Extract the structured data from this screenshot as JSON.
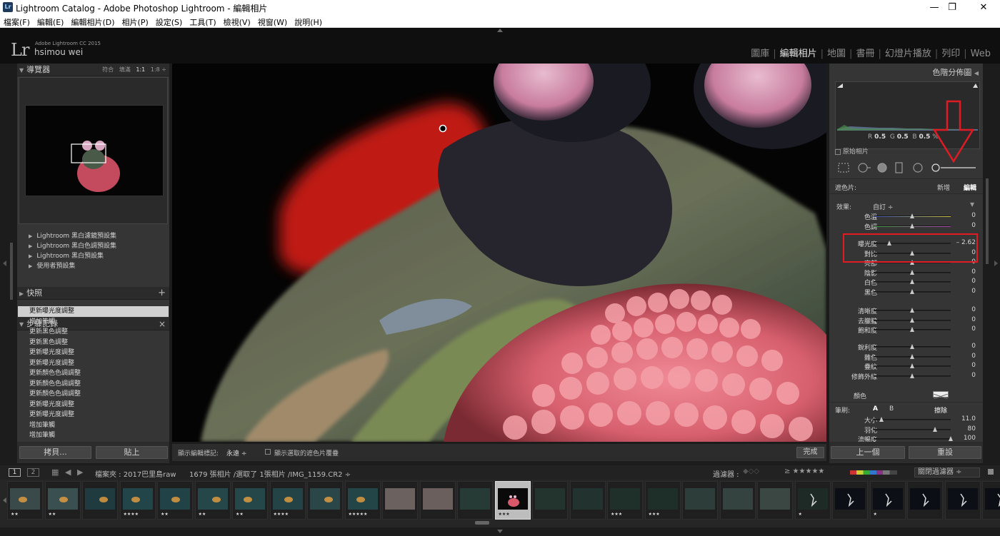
{
  "window": {
    "title": "Lightroom Catalog - Adobe Photoshop Lightroom - 編輯相片",
    "app_icon": "Lr",
    "minimize": "—",
    "maximize": "❐",
    "close": "✕"
  },
  "menu": [
    "檔案(F)",
    "編輯(E)",
    "編輯相片(D)",
    "相片(P)",
    "設定(S)",
    "工具(T)",
    "檢視(V)",
    "視窗(W)",
    "說明(H)"
  ],
  "identity": {
    "logo": "Lr",
    "product": "Adobe Lightroom CC 2015",
    "user": "hsimou wei"
  },
  "modules": [
    "圖庫",
    "編輯相片",
    "地圖",
    "書冊",
    "幻燈片播放",
    "列印",
    "Web"
  ],
  "active_module": "編輯相片",
  "navigator": {
    "title": "導覽器",
    "zoom_options": [
      "符合",
      "填滿",
      "1:1",
      "1:8 ÷"
    ]
  },
  "presets": [
    "Lightroom 黑白濾鏡預設集",
    "Lightroom 黑白色調預設集",
    "Lightroom 黑白預設集",
    "使用者預設集"
  ],
  "snapshots": {
    "title": "快照",
    "add": "+"
  },
  "history": {
    "title": "步驟記錄",
    "close": "×",
    "items": [
      "更新曝光度調整",
      "增加筆觸",
      "更新黑色調整",
      "更新黑色調整",
      "更新曝光度調整",
      "更新曝光度調整",
      "更新顏色色調調整",
      "更新顏色色調調整",
      "更新顏色色調調整",
      "更新曝光度調整",
      "更新曝光度調整",
      "增加筆觸",
      "增加筆觸"
    ]
  },
  "left_buttons": {
    "copy": "拷貝...",
    "paste": "貼上"
  },
  "histogram": {
    "title": "色階分佈圖",
    "readout": [
      "R",
      "0.5",
      "G",
      "0.5",
      "B",
      "0.5",
      "%"
    ],
    "original_label": "原始相片"
  },
  "mask": {
    "label": "遮色片:",
    "new": "新增",
    "edit": "編輯",
    "effect_label": "效果:",
    "effect_value": "自訂 ÷"
  },
  "sliders": {
    "group1": [
      {
        "label": "色溫",
        "value": "0",
        "pos": 0.5
      },
      {
        "label": "色調",
        "value": "0",
        "pos": 0.5
      }
    ],
    "group2": [
      {
        "label": "曝光度",
        "value": "– 2.62",
        "pos": 0.2
      },
      {
        "label": "對比",
        "value": "0",
        "pos": 0.5
      },
      {
        "label": "亮部",
        "value": "0",
        "pos": 0.5
      },
      {
        "label": "陰影",
        "value": "0",
        "pos": 0.5
      },
      {
        "label": "白色",
        "value": "0",
        "pos": 0.5
      },
      {
        "label": "黑色",
        "value": "0",
        "pos": 0.5
      }
    ],
    "group3": [
      {
        "label": "清晰度",
        "value": "0",
        "pos": 0.5
      },
      {
        "label": "去朦朧",
        "value": "0",
        "pos": 0.5
      },
      {
        "label": "飽和度",
        "value": "0",
        "pos": 0.5
      }
    ],
    "group4": [
      {
        "label": "銳利度",
        "value": "0",
        "pos": 0.5
      },
      {
        "label": "雜色",
        "value": "0",
        "pos": 0.5
      },
      {
        "label": "疊紋",
        "value": "0",
        "pos": 0.5
      },
      {
        "label": "修飾外緣",
        "value": "0",
        "pos": 0.5
      }
    ]
  },
  "color_label": "顏色",
  "brush": {
    "label": "筆刷:",
    "a": "A",
    "b": "B",
    "erase": "擦除",
    "size_label": "大小",
    "size_value": "11.0",
    "size_pos": 0.1,
    "feather_label": "羽化",
    "feather_value": "80",
    "feather_pos": 0.8,
    "flow_label": "流暢度",
    "flow_value": "100",
    "flow_pos": 1.0
  },
  "right_buttons": {
    "previous": "上一個",
    "reset": "重設"
  },
  "toolbar": {
    "show_edit_pins": "顯示編輯標記:",
    "edit_pins_value": "永遠 ÷",
    "show_mask_overlay": "顯示選取的遮色片覆疊",
    "done": "完成"
  },
  "filmstrip_bar": {
    "page1": "1",
    "page2": "2",
    "folder": "檔案夾 : 2017巴里島raw",
    "count": "1679 張相片 /選取了 1張相片 /IMG_1159.CR2 ÷",
    "filter_label": "過濾器 :",
    "stars_filter": "≥ ★★★★★",
    "filter_off": "關閉過濾器 ÷"
  },
  "filmstrip": [
    {
      "stars": "★★",
      "tone": "#3a4a4a"
    },
    {
      "stars": "★★",
      "tone": "#3a5050"
    },
    {
      "stars": "",
      "tone": "#1f3b3f"
    },
    {
      "stars": "★★★★",
      "tone": "#22454a"
    },
    {
      "stars": "★★",
      "tone": "#214246"
    },
    {
      "stars": "★★",
      "tone": "#254749"
    },
    {
      "stars": "★★",
      "tone": "#25474a"
    },
    {
      "stars": "★★★★",
      "tone": "#234346"
    },
    {
      "stars": "",
      "tone": "#2a4648"
    },
    {
      "stars": "★★★★★",
      "tone": "#234548"
    },
    {
      "stars": "",
      "tone": "#6b6260"
    },
    {
      "stars": "",
      "tone": "#6a5f5d"
    },
    {
      "stars": "",
      "tone": "#263b36"
    },
    {
      "stars": "★★★",
      "tone": "#0e0e0e"
    },
    {
      "stars": "",
      "tone": "#23332e"
    },
    {
      "stars": "",
      "tone": "#22332f"
    },
    {
      "stars": "★★★",
      "tone": "#1f302b"
    },
    {
      "stars": "★★★",
      "tone": "#1e2f2a"
    },
    {
      "stars": "",
      "tone": "#2d3d3a"
    },
    {
      "stars": "",
      "tone": "#34433f"
    },
    {
      "stars": "",
      "tone": "#3a4742"
    },
    {
      "stars": "★",
      "tone": "#1e2a26"
    },
    {
      "stars": "",
      "tone": "#0d0f17"
    },
    {
      "stars": "★",
      "tone": "#0d0f17"
    },
    {
      "stars": "",
      "tone": "#0c0e15"
    },
    {
      "stars": "",
      "tone": "#0d0f16"
    },
    {
      "stars": "",
      "tone": "#0c0e15"
    }
  ],
  "colors": {
    "annotation_red": "#e01b24",
    "panel_bg": "#353535",
    "app_bg": "#1c1c1c"
  }
}
